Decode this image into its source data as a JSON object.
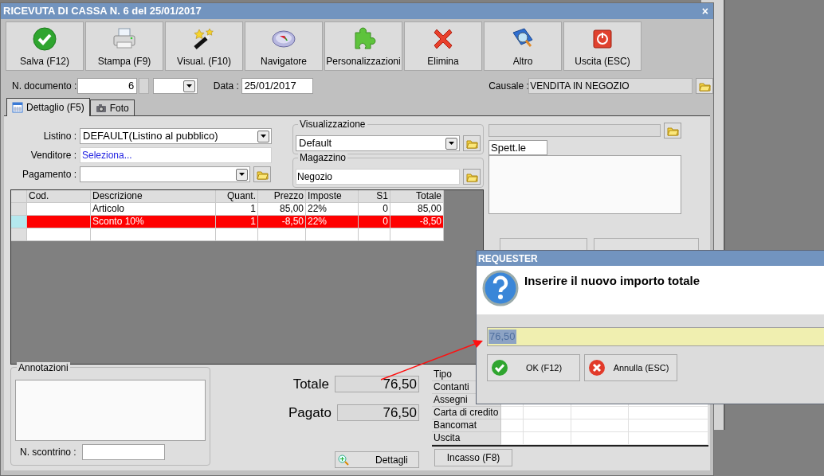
{
  "window": {
    "title": "RICEVUTA DI CASSA N. 6 del 25/01/2017",
    "close": "×"
  },
  "toolbar": [
    {
      "label": "Salva (F12)",
      "kind": "check"
    },
    {
      "label": "Stampa (F9)",
      "kind": "printer"
    },
    {
      "label": "Visual. (F10)",
      "kind": "wand"
    },
    {
      "label": "Navigatore",
      "kind": "compass"
    },
    {
      "label": "Personalizzazioni",
      "kind": "puzzle"
    },
    {
      "label": "Elimina",
      "kind": "cross"
    },
    {
      "label": "Altro",
      "kind": "book"
    },
    {
      "label": "Uscita (ESC)",
      "kind": "power"
    }
  ],
  "header": {
    "doc_label": "N. documento :",
    "doc_value": "6",
    "date_label": "Data :",
    "date_value": "25/01/2017",
    "causale_label": "Causale :",
    "causale_value": "VENDITA IN NEGOZIO"
  },
  "tabs": [
    {
      "label": "Dettaglio (F5)",
      "selected": true,
      "kind": "calendar"
    },
    {
      "label": "Foto",
      "selected": false,
      "kind": "camera"
    }
  ],
  "form": {
    "listino_label": "Listino :",
    "listino_value": "DEFAULT(Listino al pubblico)",
    "venditore_label": "Venditore :",
    "venditore_value": "Seleziona...",
    "pagamento_label": "Pagamento :"
  },
  "visualizzazione": {
    "title": "Visualizzazione",
    "value": "Default"
  },
  "magazzino": {
    "title": "Magazzino",
    "value": "Negozio"
  },
  "recipient": {
    "salutation": "Spett.le"
  },
  "table": {
    "columns": [
      "Cod.",
      "Descrizione",
      "Quant.",
      "Prezzo",
      "Imposte",
      "S1",
      "Totale"
    ],
    "rows": [
      {
        "cells": [
          "",
          "Articolo",
          "1",
          "85,00",
          "22%",
          "0",
          "85,00"
        ],
        "selected": false
      },
      {
        "cells": [
          "",
          "Sconto 10%",
          "1",
          "-8,50",
          "22%",
          "0",
          "-8,50"
        ],
        "selected": true
      }
    ]
  },
  "notes": {
    "title": "Annotazioni",
    "receipt_label": "N. scontrino :"
  },
  "totals": [
    {
      "label": "Totale",
      "value": "76,50"
    },
    {
      "label": "Pagato",
      "value": "76,50"
    }
  ],
  "details_button": "Dettagli",
  "payments": {
    "header": "Tipo",
    "rows": [
      "Contanti",
      "Assegni",
      "Carta di credito",
      "Bancomat",
      "Uscita"
    ],
    "button": "Incasso (F8)"
  },
  "dialog": {
    "title": "REQUESTER",
    "message": "Inserire il nuovo importo totale",
    "value": "76,50",
    "value_selected": true,
    "buttons": [
      {
        "label": "OK (F12)",
        "kind": "ok"
      },
      {
        "label": "Annulla (ESC)",
        "kind": "cancel"
      }
    ]
  }
}
